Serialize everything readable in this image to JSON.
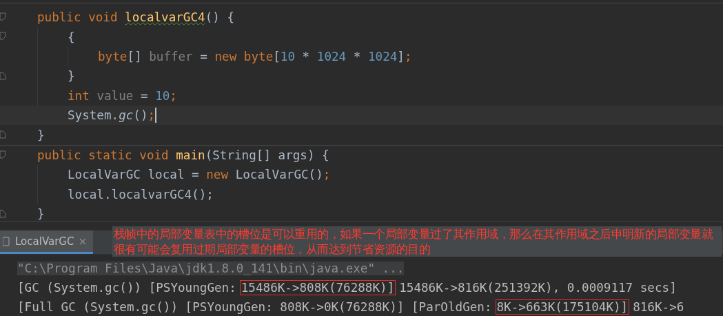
{
  "editor": {
    "lines": [
      {
        "fold_start": true,
        "tokens": [
          {
            "text": "public void ",
            "kind": "keyword"
          },
          {
            "text": "localvarGC4",
            "kind": "declaration",
            "warning": true
          },
          {
            "text": "() {",
            "kind": "plain"
          }
        ],
        "children": [
          {
            "fold_start": true,
            "tokens": [
              {
                "text": "{",
                "kind": "plain"
              }
            ],
            "children": [
              {
                "tokens": [
                  {
                    "text": "byte",
                    "kind": "keyword"
                  },
                  {
                    "text": "[] ",
                    "kind": "plain"
                  },
                  {
                    "text": "buffer",
                    "kind": "unused"
                  },
                  {
                    "text": " = ",
                    "kind": "plain"
                  },
                  {
                    "text": "new byte",
                    "kind": "keyword"
                  },
                  {
                    "text": "[",
                    "kind": "plain"
                  },
                  {
                    "text": "10",
                    "kind": "number"
                  },
                  {
                    "text": " * ",
                    "kind": "plain"
                  },
                  {
                    "text": "1024",
                    "kind": "number"
                  },
                  {
                    "text": " * ",
                    "kind": "plain"
                  },
                  {
                    "text": "1024",
                    "kind": "number"
                  },
                  {
                    "text": "]",
                    "kind": "plain"
                  },
                  {
                    "text": ";",
                    "kind": "keyword"
                  }
                ]
              }
            ]
          },
          {
            "fold_end": true,
            "tokens": [
              {
                "text": "}",
                "kind": "plain"
              }
            ]
          },
          {
            "tokens": [
              {
                "text": "int ",
                "kind": "keyword"
              },
              {
                "text": "value",
                "kind": "unused"
              },
              {
                "text": " = ",
                "kind": "plain"
              },
              {
                "text": "10",
                "kind": "number"
              },
              {
                "text": ";",
                "kind": "keyword"
              }
            ]
          },
          {
            "current": true,
            "tokens": [
              {
                "text": "System.",
                "kind": "plain"
              },
              {
                "text": "gc",
                "kind": "static"
              },
              {
                "text": "()",
                "kind": "plain"
              },
              {
                "text": ";",
                "kind": "keyword"
              }
            ]
          }
        ]
      },
      {
        "fold_end": true,
        "separator": true,
        "tokens": [
          {
            "text": "}",
            "kind": "plain"
          }
        ]
      },
      {
        "fold_start": true,
        "tokens": [
          {
            "text": "public static void ",
            "kind": "keyword"
          },
          {
            "text": "main",
            "kind": "declaration"
          },
          {
            "text": "(String[] args) {",
            "kind": "plain"
          }
        ],
        "children": [
          {
            "tokens": [
              {
                "text": "LocalVarGC local = ",
                "kind": "plain"
              },
              {
                "text": "new ",
                "kind": "keyword"
              },
              {
                "text": "LocalVarGC()",
                "kind": "plain"
              },
              {
                "text": ";",
                "kind": "keyword"
              }
            ]
          },
          {
            "tokens": [
              {
                "text": "local.localvarGC4();",
                "kind": "plain"
              }
            ]
          }
        ]
      },
      {
        "fold_end": true,
        "tokens": [
          {
            "text": "}",
            "kind": "plain"
          }
        ]
      }
    ]
  },
  "run_panel": {
    "tabs": [
      {
        "label": "LocalVarGC",
        "selected": true
      }
    ],
    "note": "栈帧中的局部变量表中的槽位是可以重用的，如果一个局部变量过了其作用域，那么在其作用域之后申明新的局部变量就很有可能会复用过期局部变量的槽位，从而达到节省资源的目的",
    "console": [
      {
        "kind": "command",
        "segments": [
          {
            "text": "\"C:\\Program Files\\Java\\jdk1.8.0_141\\bin\\java.exe\" ...",
            "boxed": false
          }
        ]
      },
      {
        "kind": "output",
        "segments": [
          {
            "text": "[GC (System.gc()) [PSYoungGen:",
            "boxed": false
          },
          {
            "text": "15486K->808K(76288K)]",
            "boxed": true
          },
          {
            "text": "15486K->816K(251392K), 0.0009117 secs]",
            "boxed": false
          }
        ]
      },
      {
        "kind": "output",
        "segments": [
          {
            "text": "[Full GC (System.gc()) [PSYoungGen: 808K->0K(76288K)] [ParOldGen:",
            "boxed": false
          },
          {
            "text": "8K->663K(175104K)]",
            "boxed": true
          },
          {
            "text": "816K->6",
            "boxed": false
          }
        ]
      }
    ]
  }
}
